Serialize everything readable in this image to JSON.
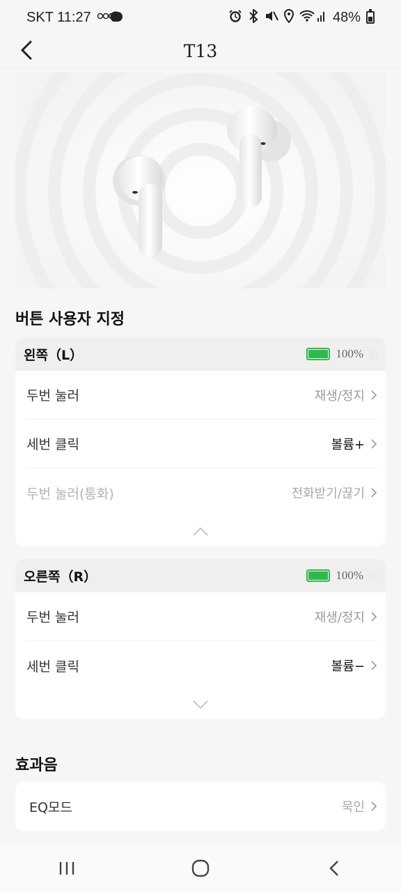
{
  "status_bar": {
    "carrier_time": "SKT 11:27",
    "battery_percent": "48%"
  },
  "header": {
    "title": "T13",
    "back_icon": "chevron-left-icon"
  },
  "hero": {
    "image": "earbuds-illustration"
  },
  "button_section": {
    "title": "버튼 사용자 지정",
    "left": {
      "label": "왼쪽（L）",
      "battery": "100%",
      "battery_fraction": 1.0,
      "rows": [
        {
          "label": "두번 눌러",
          "value": "재생/정지",
          "style": "muted"
        },
        {
          "label": "세번 클릭",
          "value": "볼륨+",
          "style": "strong"
        },
        {
          "label": "두번 눌러(통화)",
          "value": "전화받기/끊기",
          "style": "disabled"
        }
      ]
    },
    "right": {
      "label": "오른쪽（R）",
      "battery": "100%",
      "battery_fraction": 1.0,
      "rows": [
        {
          "label": "두번 눌러",
          "value": "재생/정지",
          "style": "muted"
        },
        {
          "label": "세번 클릭",
          "value": "볼륨−",
          "style": "strong"
        }
      ]
    }
  },
  "effects_section": {
    "title": "효과음",
    "rows": [
      {
        "label": "EQ모드",
        "value": "묵인"
      }
    ]
  },
  "nav_bar": {
    "recents_icon": "recent-apps-icon",
    "home_icon": "home-icon",
    "back_icon": "back-icon"
  },
  "colors": {
    "battery_green": "#2fb84f",
    "background": "#f6f6f6"
  }
}
